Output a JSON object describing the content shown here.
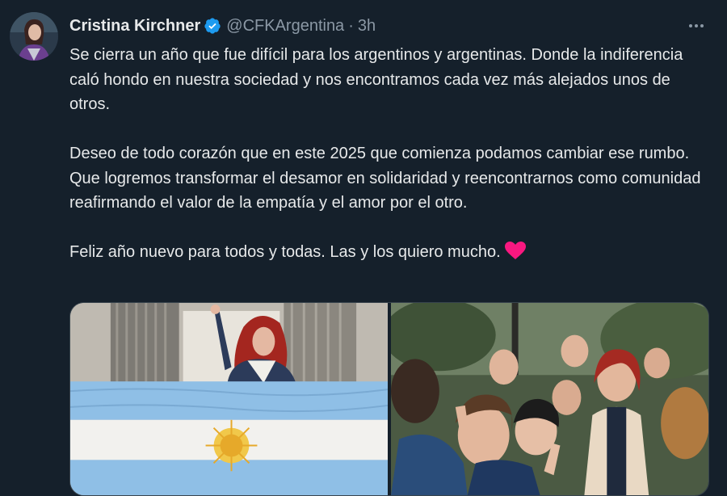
{
  "tweet": {
    "author_name": "Cristina Kirchner",
    "handle": "@CFKArgentina",
    "separator": "·",
    "time": "3h",
    "paragraphs": [
      "Se cierra un año que fue difícil para los argentinos y argentinas. Donde la indiferencia caló hondo en nuestra sociedad y nos encontramos cada vez más alejados unos de otros.",
      "Deseo de todo corazón que en este 2025 que comienza podamos cambiar ese rumbo. Que logremos transformar el desamor en solidaridad y reencontrarnos como comunidad reafirmando el valor de la empatía y el amor por el otro.",
      "Feliz año nuevo para todos y todas. Las y los quiero mucho."
    ],
    "emoji": "heart-icon"
  },
  "colors": {
    "background": "#15202b",
    "text": "#e7e9ea",
    "muted": "#8b98a5",
    "verified": "#1d9bf0",
    "heart": "#f91880"
  },
  "media": [
    {
      "icon": "photo-balcony-flag"
    },
    {
      "icon": "photo-group-selfie"
    }
  ]
}
